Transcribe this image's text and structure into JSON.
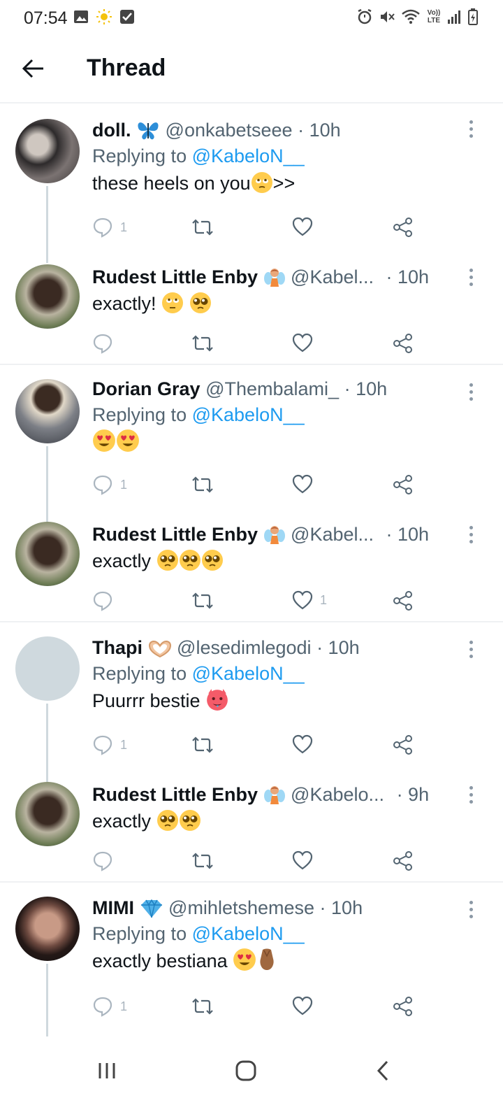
{
  "status_bar": {
    "time": "07:54",
    "left_icons": [
      "gallery-icon",
      "sun-icon",
      "checkbox-icon"
    ],
    "right_icons": [
      "alarm-icon",
      "mute-icon",
      "wifi-icon",
      "volte-icon",
      "signal-icon",
      "battery-icon"
    ],
    "volte_label": "Vo))\nLTE"
  },
  "header": {
    "title": "Thread",
    "back_icon": "back-arrow-icon"
  },
  "tweets": [
    {
      "name": "doll.",
      "name_icon": "butterfly-emoji",
      "handle": "@onkabetseee",
      "time": "· 10h",
      "replying_prefix": "Replying to",
      "replying_to": "@KabeloN__",
      "text": "these heels on you",
      "text_suffix": ">>",
      "emoji": [
        "pleading-roll-eyes-emoji"
      ],
      "reply_count": "1",
      "like_count": ""
    },
    {
      "name": "Rudest Little Enby",
      "name_icon": "fairy-emoji",
      "handle": "@Kabel...",
      "time": "· 10h",
      "text": "exactly!",
      "emoji": [
        "roll-eyes-emoji",
        "pleading-emoji"
      ],
      "reply_count": "",
      "like_count": ""
    },
    {
      "name": "Dorian Gray",
      "handle": "@Thembalami_",
      "time": "· 10h",
      "replying_prefix": "Replying to",
      "replying_to": "@KabeloN__",
      "text": "",
      "emoji": [
        "heart-eyes-emoji",
        "heart-eyes-emoji"
      ],
      "reply_count": "1",
      "like_count": ""
    },
    {
      "name": "Rudest Little Enby",
      "name_icon": "fairy-emoji",
      "handle": "@Kabel...",
      "time": "· 10h",
      "text": "exactly",
      "emoji": [
        "pleading-emoji",
        "pleading-emoji",
        "pleading-emoji"
      ],
      "reply_count": "",
      "like_count": "1"
    },
    {
      "name": "Thapi",
      "name_icon": "heart-hands-emoji",
      "handle": "@lesedimlegodi",
      "time": "· 10h",
      "replying_prefix": "Replying to",
      "replying_to": "@KabeloN__",
      "text": "Puurrr bestie",
      "emoji": [
        "hot-face-devil-emoji"
      ],
      "reply_count": "1",
      "like_count": ""
    },
    {
      "name": "Rudest Little Enby",
      "name_icon": "fairy-emoji",
      "handle": "@Kabelo...",
      "time": "· 9h",
      "text": "exactly",
      "emoji": [
        "pleading-emoji",
        "pleading-emoji"
      ],
      "reply_count": "",
      "like_count": ""
    },
    {
      "name": "MIMI",
      "name_icon": "diamond-emoji",
      "handle": "@mihletshemese",
      "time": "· 10h",
      "replying_prefix": "Replying to",
      "replying_to": "@KabeloN__",
      "text": "exactly bestiana",
      "emoji": [
        "heart-eyes-emoji",
        "pinched-fingers-emoji"
      ],
      "reply_count": "1",
      "like_count": ""
    }
  ],
  "nav": {
    "icons": [
      "recents-icon",
      "home-icon",
      "back-icon"
    ]
  },
  "colors": {
    "mention": "#1d9bf0",
    "text": "#0f1419",
    "secondary": "#536471",
    "icon": "#aab5bf"
  }
}
